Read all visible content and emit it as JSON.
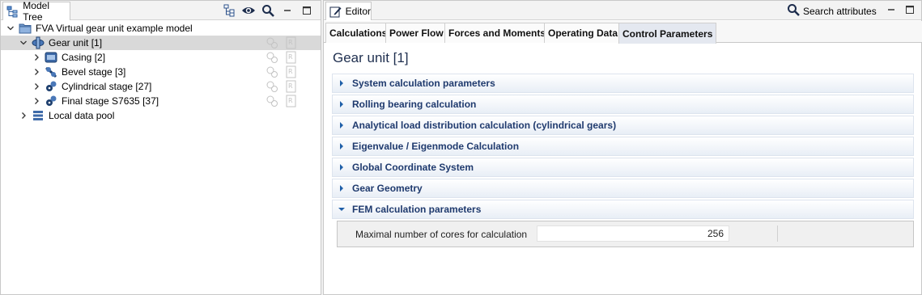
{
  "model_tree": {
    "tab_label": "Model Tree",
    "toolbar_icons": [
      "tree-layout-icon",
      "eye-icon",
      "search-icon",
      "minimize-icon",
      "maximize-icon"
    ],
    "items": [
      {
        "label": "FVA Virtual gear unit example model",
        "icon": "folder-icon",
        "level": 0,
        "expanded": true
      },
      {
        "label": "Gear unit [1]",
        "icon": "gear-unit-icon",
        "level": 1,
        "expanded": true,
        "selected": true
      },
      {
        "label": "Casing [2]",
        "icon": "casing-icon",
        "level": 2,
        "expanded": false
      },
      {
        "label": "Bevel stage [3]",
        "icon": "bevel-stage-icon",
        "level": 2,
        "expanded": false
      },
      {
        "label": "Cylindrical stage [27]",
        "icon": "cylindrical-stage-icon",
        "level": 2,
        "expanded": false
      },
      {
        "label": "Final stage S7635 [37]",
        "icon": "final-stage-icon",
        "level": 2,
        "expanded": false
      },
      {
        "label": "Local data pool",
        "icon": "data-pool-icon",
        "level": 1,
        "expanded": false
      }
    ]
  },
  "editor": {
    "tab_label": "Editor",
    "search_label": "Search attributes",
    "subtabs": [
      {
        "label": "Calculations",
        "active": false
      },
      {
        "label": "Power Flow",
        "active": false
      },
      {
        "label": "Forces and Moments",
        "active": false
      },
      {
        "label": "Operating Data",
        "active": false
      },
      {
        "label": "Control Parameters",
        "active": true
      }
    ],
    "page_title": "Gear unit [1]",
    "sections": [
      {
        "label": "System calculation parameters",
        "expanded": false
      },
      {
        "label": "Rolling bearing calculation",
        "expanded": false
      },
      {
        "label": "Analytical load distribution calculation (cylindrical gears)",
        "expanded": false
      },
      {
        "label": "Eigenvalue / Eigenmode Calculation",
        "expanded": false
      },
      {
        "label": "Global Coordinate System",
        "expanded": false
      },
      {
        "label": "Gear Geometry",
        "expanded": false
      },
      {
        "label": "FEM calculation parameters",
        "expanded": true
      }
    ],
    "fem": {
      "label": "Maximal number of cores for calculation",
      "value": "256"
    }
  },
  "colors": {
    "section_text": "#1f3a6e",
    "title_text": "#1f2f4f",
    "selected_row": "#d9d9d9",
    "twisty": "#1f5fa8"
  }
}
